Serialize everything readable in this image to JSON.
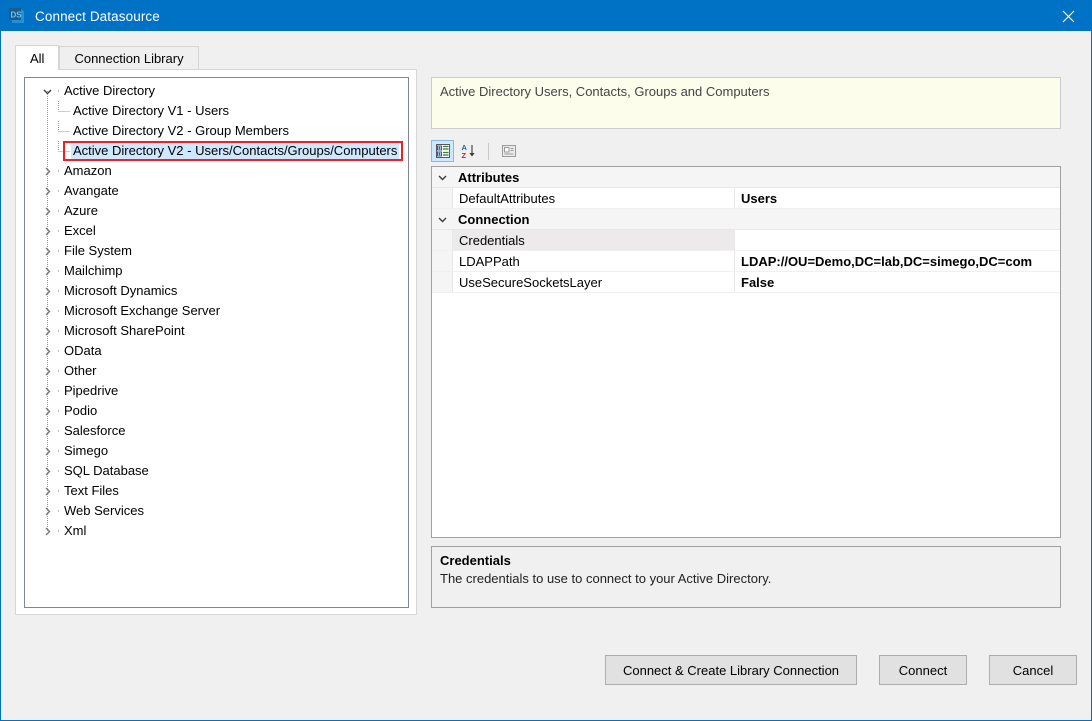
{
  "window": {
    "title": "Connect Datasource",
    "icon": "ds-app-icon",
    "close_label": "✕",
    "titlebar_color": "#0072c6"
  },
  "tabs": [
    {
      "label": "All",
      "active": true
    },
    {
      "label": "Connection Library",
      "active": false
    }
  ],
  "tree": {
    "nodes": [
      {
        "label": "Active Directory",
        "level": 0,
        "state": "expanded",
        "selected": false
      },
      {
        "label": "Active Directory V1 - Users",
        "level": 1,
        "state": "leaf",
        "selected": false
      },
      {
        "label": "Active Directory V2 - Group Members",
        "level": 1,
        "state": "leaf",
        "selected": false
      },
      {
        "label": "Active Directory V2 - Users/Contacts/Groups/Computers",
        "level": 1,
        "state": "leaf",
        "selected": true
      },
      {
        "label": "Amazon",
        "level": 0,
        "state": "collapsed",
        "selected": false
      },
      {
        "label": "Avangate",
        "level": 0,
        "state": "collapsed",
        "selected": false
      },
      {
        "label": "Azure",
        "level": 0,
        "state": "collapsed",
        "selected": false
      },
      {
        "label": "Excel",
        "level": 0,
        "state": "collapsed",
        "selected": false
      },
      {
        "label": "File System",
        "level": 0,
        "state": "collapsed",
        "selected": false
      },
      {
        "label": "Mailchimp",
        "level": 0,
        "state": "collapsed",
        "selected": false
      },
      {
        "label": "Microsoft Dynamics",
        "level": 0,
        "state": "collapsed",
        "selected": false
      },
      {
        "label": "Microsoft Exchange Server",
        "level": 0,
        "state": "collapsed",
        "selected": false
      },
      {
        "label": "Microsoft SharePoint",
        "level": 0,
        "state": "collapsed",
        "selected": false
      },
      {
        "label": "OData",
        "level": 0,
        "state": "collapsed",
        "selected": false
      },
      {
        "label": "Other",
        "level": 0,
        "state": "collapsed",
        "selected": false
      },
      {
        "label": "Pipedrive",
        "level": 0,
        "state": "collapsed",
        "selected": false
      },
      {
        "label": "Podio",
        "level": 0,
        "state": "collapsed",
        "selected": false
      },
      {
        "label": "Salesforce",
        "level": 0,
        "state": "collapsed",
        "selected": false
      },
      {
        "label": "Simego",
        "level": 0,
        "state": "collapsed",
        "selected": false
      },
      {
        "label": "SQL Database",
        "level": 0,
        "state": "collapsed",
        "selected": false
      },
      {
        "label": "Text Files",
        "level": 0,
        "state": "collapsed",
        "selected": false
      },
      {
        "label": "Web Services",
        "level": 0,
        "state": "collapsed",
        "selected": false
      },
      {
        "label": "Xml",
        "level": 0,
        "state": "collapsed",
        "selected": false
      }
    ],
    "highlight_color": "#e8232a",
    "selection_color": "#cde8ff"
  },
  "datasource_description": "Active Directory Users, Contacts, Groups and Computers",
  "property_toolbar": {
    "buttons": [
      {
        "name": "categorized-view-button",
        "checked": true
      },
      {
        "name": "alphabetical-sort-button",
        "checked": false
      },
      {
        "name": "property-pages-button",
        "checked": false
      }
    ]
  },
  "property_grid": {
    "rows": [
      {
        "kind": "category",
        "name": "Attributes",
        "value": "",
        "expanded": true,
        "selected": false
      },
      {
        "kind": "property",
        "name": "DefaultAttributes",
        "value": "Users",
        "selected": false
      },
      {
        "kind": "category",
        "name": "Connection",
        "value": "",
        "expanded": true,
        "selected": false
      },
      {
        "kind": "property",
        "name": "Credentials",
        "value": "",
        "selected": true
      },
      {
        "kind": "property",
        "name": "LDAPPath",
        "value": "LDAP://OU=Demo,DC=lab,DC=simego,DC=com",
        "selected": false
      },
      {
        "kind": "property",
        "name": "UseSecureSocketsLayer",
        "value": "False",
        "selected": false
      }
    ]
  },
  "description_pane": {
    "title": "Credentials",
    "text": "The credentials to use to connect to your Active Directory."
  },
  "footer": {
    "connect_create_label": "Connect & Create Library Connection",
    "connect_label": "Connect",
    "cancel_label": "Cancel"
  }
}
